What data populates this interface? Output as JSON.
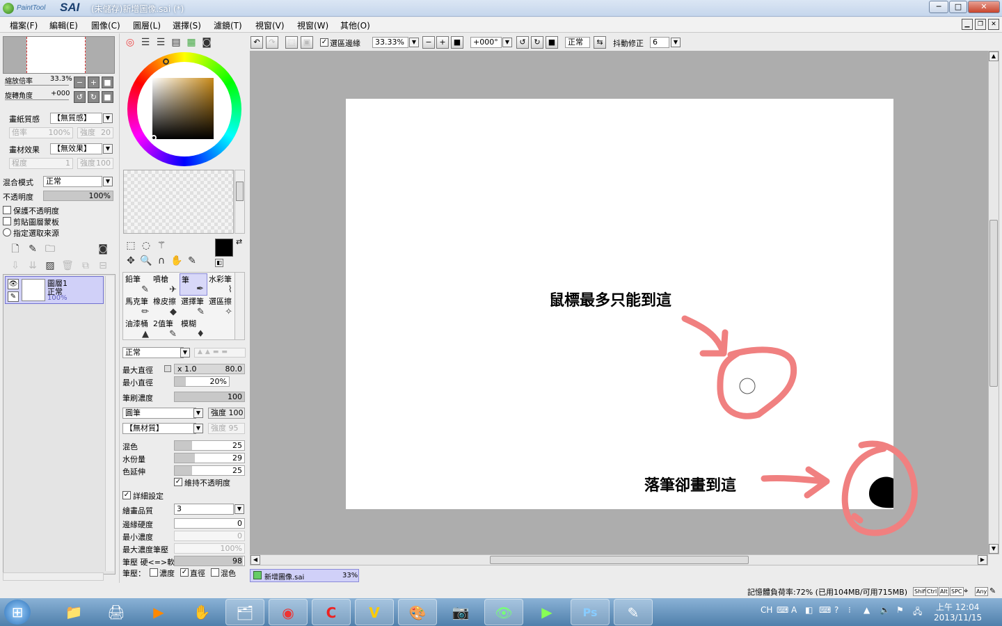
{
  "window": {
    "app_logo_small": "PaintTool",
    "app_logo_big": "SAI",
    "title": "(未儲存)新增圖像.sai (*)",
    "min": "─",
    "max": "□",
    "close": "✕"
  },
  "menu": [
    "檔案(F)",
    "編輯(E)",
    "圖像(C)",
    "圖層(L)",
    "選擇(S)",
    "濾鏡(T)",
    "視窗(V)",
    "視窗(W)",
    "其他(O)"
  ],
  "navigator": {
    "zoom_label": "縮放倍率",
    "zoom_value": "33.3%",
    "rotate_label": "旋轉角度",
    "rotate_value": "+000"
  },
  "paper": {
    "texture_label": "畫紙質感",
    "texture_value": "【無質感】",
    "rate_label": "倍率",
    "rate_value": "100%",
    "strength_label": "強度",
    "strength_value": "20",
    "effect_label": "畫材效果",
    "effect_value": "【無效果】",
    "degree_label": "程度",
    "degree_value": "1",
    "effect_strength_label": "強度",
    "effect_strength_value": "100"
  },
  "layer_props": {
    "blend_label": "混合模式",
    "blend_value": "正常",
    "opacity_label": "不透明度",
    "opacity_value": "100%",
    "opacity_fraction": 1.0,
    "protect_opacity": "保護不透明度",
    "clip_mask": "剪貼圖層蒙板",
    "select_source": "指定選取來源"
  },
  "layer": {
    "name": "圖層1",
    "mode": "正常",
    "opacity": "100%"
  },
  "brush": {
    "mode": "正常",
    "max_size_label": "最大直徑",
    "max_size_mult": "x 1.0",
    "max_size_value": "80.0",
    "min_size_label": "最小直徑",
    "min_size_value": "20%",
    "min_size_fraction": 0.2,
    "density_label": "筆刷濃度",
    "density_value": "100",
    "density_fraction": 1.0,
    "shape": "圓筆",
    "shape_strength": "強度 100",
    "texture": "【無材質】",
    "texture_strength": "強度 95",
    "blend_label": "混色",
    "blend_value": "25",
    "blend_fraction": 0.25,
    "water_label": "水份量",
    "water_value": "29",
    "water_fraction": 0.29,
    "persist_label": "色延伸",
    "persist_value": "25",
    "persist_fraction": 0.25,
    "keep_opacity": "維持不透明度",
    "advanced": "詳細設定",
    "quality_label": "繪畫品質",
    "quality_value": "3",
    "edge_label": "邊緣硬度",
    "edge_value": "0",
    "min_density_label": "最小濃度",
    "min_density_value": "0",
    "max_pressure_label": "最大濃度筆壓",
    "max_pressure_value": "100%",
    "hardness_label": "筆壓 硬<=>軟",
    "hardness_value": "98",
    "hardness_fraction": 0.98,
    "pressure_label": "筆壓：",
    "pressure_density": "濃度",
    "pressure_size": "直徑",
    "pressure_blend": "混色"
  },
  "tools": [
    "鉛筆",
    "噴槍",
    "筆",
    "水彩筆",
    "馬克筆",
    "橡皮擦",
    "選擇筆",
    "選區擦",
    "油漆桶",
    "2值筆",
    "模糊"
  ],
  "tool_glyphs": [
    "✎",
    "✈",
    "✒",
    "⌇",
    "✏",
    "◆",
    "✎",
    "✧",
    "▲",
    "✎",
    "♦"
  ],
  "toolbar": {
    "selection_edge": "選區邊緣",
    "zoom": "33.33%",
    "rotation": "+000°",
    "mode": "正常",
    "stabilizer_label": "抖動修正",
    "stabilizer_value": "6"
  },
  "annotations": {
    "cursor_note": "鼠標最多只能到這",
    "stroke_note": "落筆卻畫到這"
  },
  "document_tab": {
    "name": "新增圖像.sai",
    "zoom": "33%"
  },
  "status": {
    "memory": "記憶體負荷率:72% (已用104MB/可用715MB)",
    "keys": [
      "Shift",
      "Ctrl",
      "Alt",
      "SPC",
      "Any"
    ]
  },
  "taskbar": {
    "start": "⊞",
    "apps": [
      "folder-icon",
      "scanner-icon",
      "media-player-icon",
      "hand-icon",
      "file-manager-icon",
      "chrome-icon",
      "c-app-icon",
      "v-app-icon",
      "sai-icon",
      "webcam-icon",
      "eye-icon",
      "play-icon",
      "photoshop-icon",
      "pen-tablet-icon"
    ],
    "app_glyphs": [
      "📁",
      "🖨",
      "▶",
      "✋",
      "🗂",
      "◉",
      "C",
      "V",
      "🎨",
      "📷",
      "👁",
      "▶",
      "Ps",
      "✎"
    ],
    "tray_lang": "CH",
    "time": "上午 12:04",
    "date": "2013/11/15"
  },
  "colors": {
    "accent": "#8a8ad8",
    "annotation_pink": "#f08080",
    "canvas_bg": "#adadad",
    "taskbar": "#5d8bb8"
  }
}
